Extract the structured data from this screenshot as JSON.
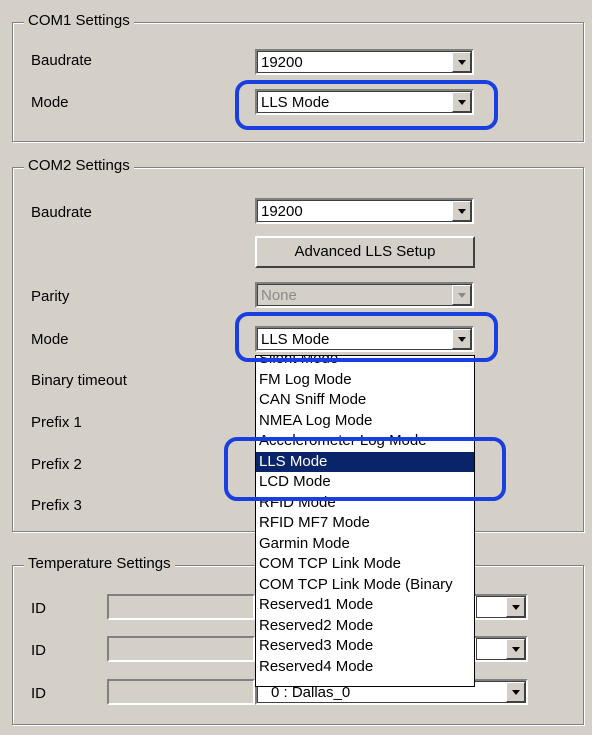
{
  "com1": {
    "title": "COM1 Settings",
    "baudrate_label": "Baudrate",
    "baudrate_value": "19200",
    "mode_label": "Mode",
    "mode_value": "LLS Mode"
  },
  "com2": {
    "title": "COM2 Settings",
    "baudrate_label": "Baudrate",
    "baudrate_value": "19200",
    "advanced_button": "Advanced LLS Setup",
    "parity_label": "Parity",
    "parity_value": "None",
    "mode_label": "Mode",
    "mode_value": "LLS Mode",
    "binary_timeout_label": "Binary timeout",
    "prefix1_label": "Prefix 1",
    "prefix2_label": "Prefix 2",
    "prefix3_label": "Prefix 3"
  },
  "mode_dropdown": {
    "options": [
      "Silent Mode",
      "FM Log Mode",
      "CAN Sniff Mode",
      "NMEA Log Mode",
      "Accelerometer Log Mode",
      "LLS Mode",
      "LCD Mode",
      "RFID Mode",
      "RFID MF7 Mode",
      "Garmin Mode",
      "COM TCP Link Mode",
      "COM TCP Link Mode (Binary",
      "Reserved1 Mode",
      "Reserved2 Mode",
      "Reserved3 Mode",
      "Reserved4 Mode"
    ],
    "selected": "LLS Mode"
  },
  "temperature": {
    "title": "Temperature Settings",
    "id_label": "ID",
    "row3_value": "0 : Dallas_0"
  },
  "colors": {
    "highlight_ring": "#1a3fe0",
    "selection": "#0a246a",
    "window_bg": "#d4d0c8"
  }
}
